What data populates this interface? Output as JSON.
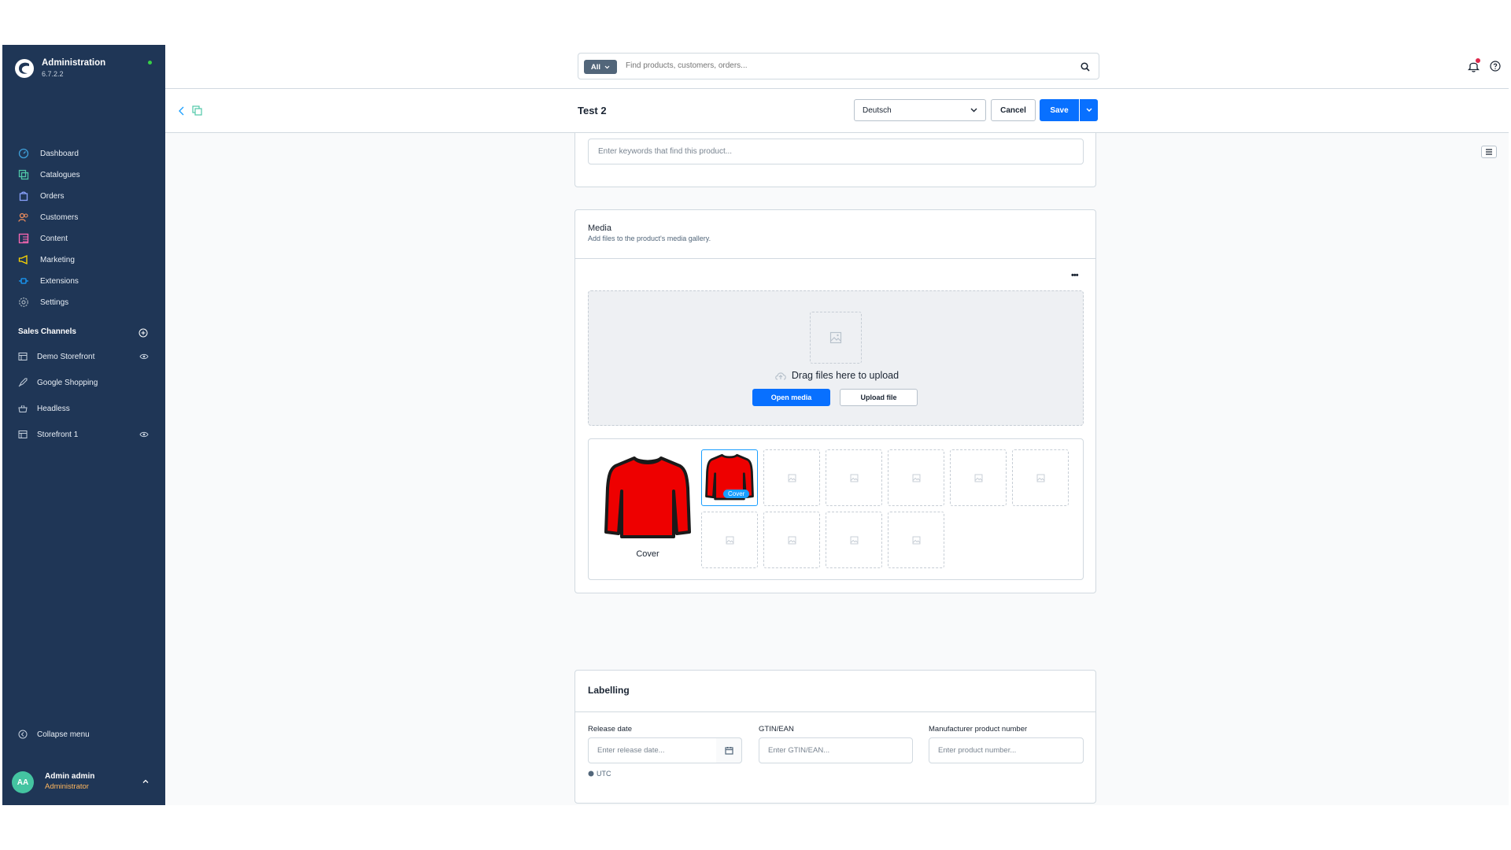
{
  "app": {
    "title": "Administration",
    "version": "6.7.2.2"
  },
  "sidebar": {
    "items": [
      {
        "label": "Dashboard",
        "icon": "dashboard-icon",
        "color": "#3e9fd9"
      },
      {
        "label": "Catalogues",
        "icon": "catalogue-icon",
        "color": "#4fc7a8"
      },
      {
        "label": "Orders",
        "icon": "orders-icon",
        "color": "#8ba3ff"
      },
      {
        "label": "Customers",
        "icon": "customers-icon",
        "color": "#f18e5c"
      },
      {
        "label": "Content",
        "icon": "content-icon",
        "color": "#ff68b4"
      },
      {
        "label": "Marketing",
        "icon": "marketing-icon",
        "color": "#ffd700"
      },
      {
        "label": "Extensions",
        "icon": "extensions-icon",
        "color": "#189eff"
      },
      {
        "label": "Settings",
        "icon": "settings-icon",
        "color": "#9aa8b5"
      }
    ],
    "sales_channels_title": "Sales Channels",
    "sales_channels": [
      {
        "label": "Demo Storefront",
        "icon": "storefront-icon",
        "has_eye": true
      },
      {
        "label": "Google Shopping",
        "icon": "rocket-icon",
        "has_eye": false
      },
      {
        "label": "Headless",
        "icon": "basket-icon",
        "has_eye": false
      },
      {
        "label": "Storefront 1",
        "icon": "storefront-icon",
        "has_eye": true
      }
    ],
    "collapse_label": "Collapse menu",
    "user": {
      "initials": "AA",
      "name": "Admin admin",
      "role": "Administrator"
    }
  },
  "search": {
    "type_label": "All",
    "placeholder": "Find products, customers, orders..."
  },
  "smartbar": {
    "title": "Test 2",
    "language": "Deutsch",
    "cancel_label": "Cancel",
    "save_label": "Save"
  },
  "keywords": {
    "placeholder": "Enter keywords that find this product..."
  },
  "media": {
    "title": "Media",
    "subtitle": "Add files to the product's media gallery.",
    "drop_text": "Drag files here to upload",
    "open_media_label": "Open media",
    "upload_file_label": "Upload file",
    "cover_label": "Cover",
    "cover_badge": "Cover"
  },
  "labelling": {
    "title": "Labelling",
    "release_date_label": "Release date",
    "release_date_placeholder": "Enter release date...",
    "timezone": "UTC",
    "gtin_label": "GTIN/EAN",
    "gtin_placeholder": "Enter GTIN/EAN...",
    "mpn_label": "Manufacturer product number",
    "mpn_placeholder": "Enter product number..."
  },
  "colors": {
    "sidebar_bg": "#1f3656",
    "primary": "#0870ff",
    "status_online": "#37d046",
    "role_text": "#ffb75d",
    "avatar": "#44c4a1"
  }
}
